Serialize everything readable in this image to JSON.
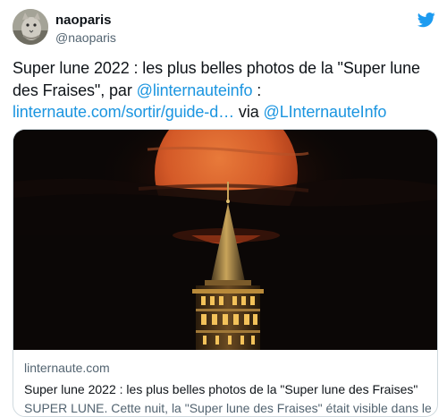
{
  "author": {
    "display_name": "naoparis",
    "handle": "@naoparis"
  },
  "icons": {
    "avatar": "cat-avatar",
    "logo": "twitter-bird-icon"
  },
  "tweet": {
    "text_1": "Super lune 2022 : les plus belles photos de la \"Super lune des Fraises\", par ",
    "mention_1": "@linternauteinfo",
    "text_2": " : ",
    "link": "linternaute.com/sortir/guide-d…",
    "text_3": " via ",
    "mention_2": "@LInternauteInfo"
  },
  "card": {
    "domain": "linternaute.com",
    "title": "Super lune 2022 : les plus belles photos de la \"Super lune des Fraises\"",
    "description": "SUPER LUNE. Cette nuit, la \"Super lune des Fraises\" était visible dans le ciel..."
  },
  "colors": {
    "link": "#1b95e0",
    "text": "#0f1419",
    "secondary": "#536471",
    "border": "#cfd9de",
    "twitter_blue": "#1d9bf0",
    "moon": "#d9572a"
  }
}
